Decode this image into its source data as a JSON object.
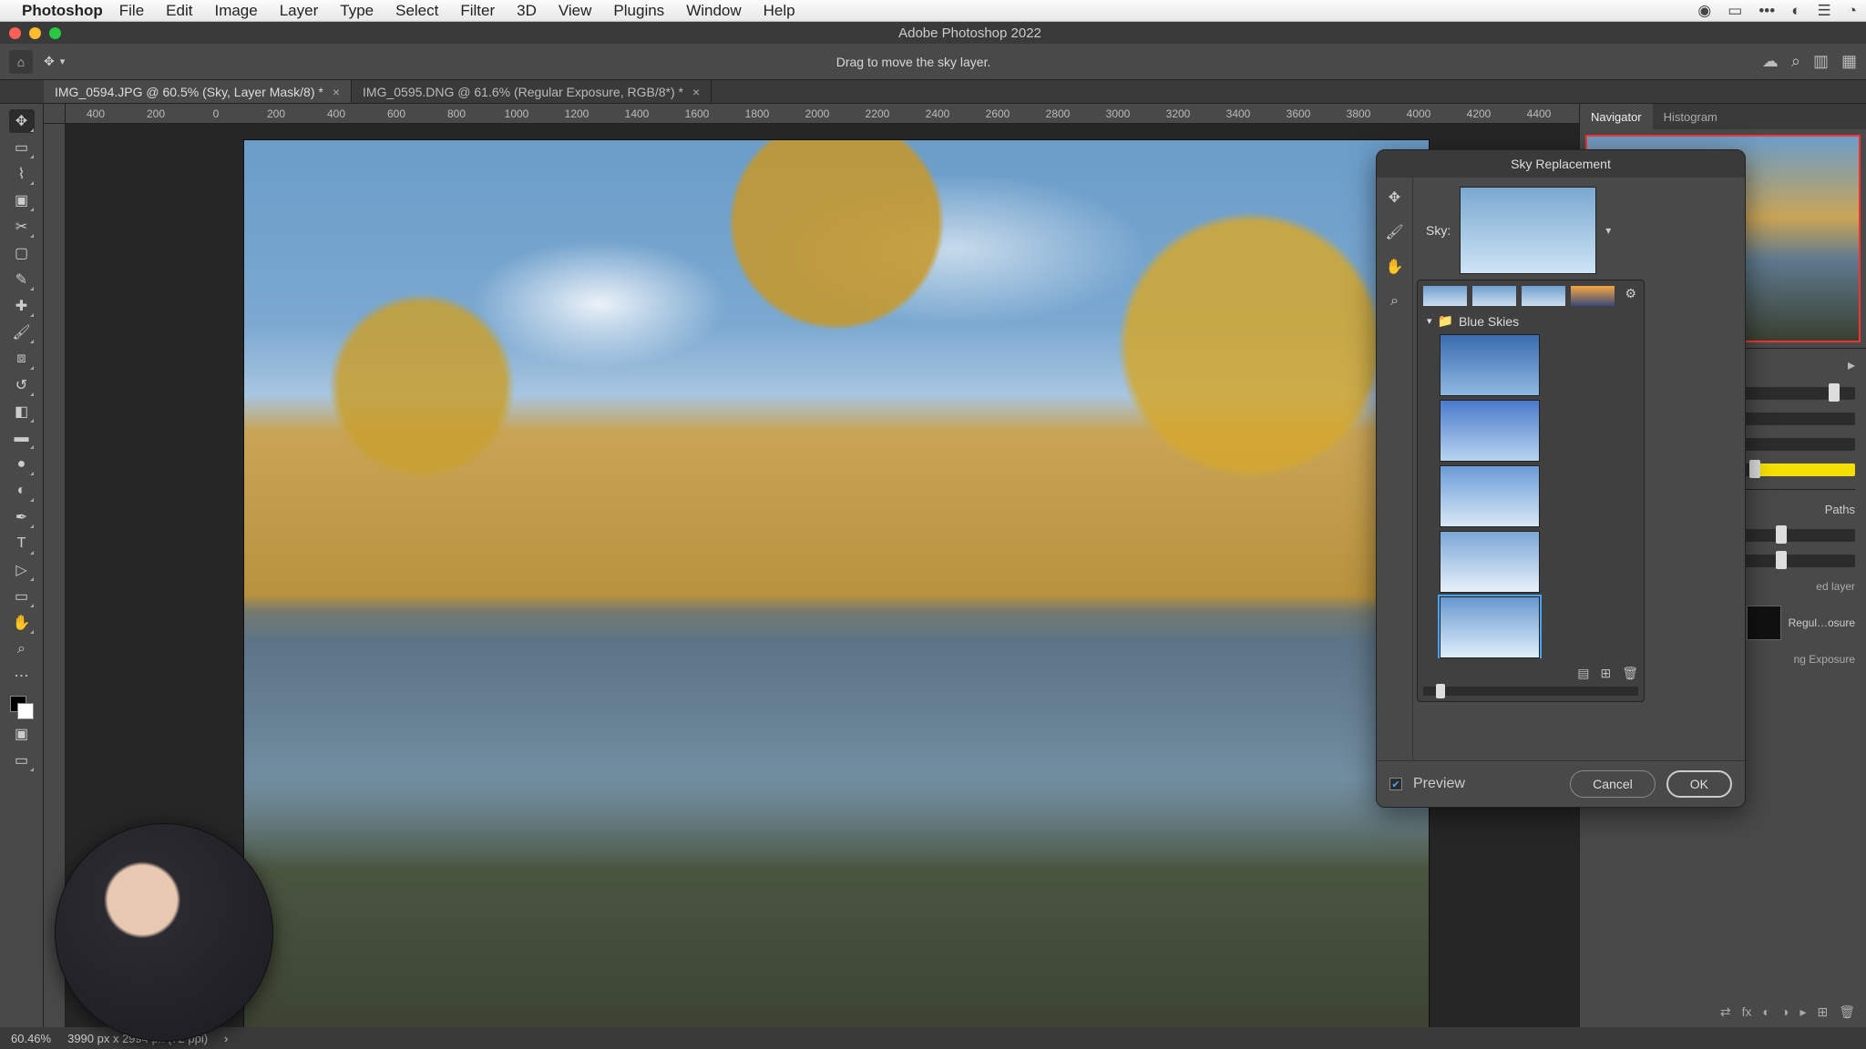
{
  "menubar": {
    "app": "Photoshop",
    "items": [
      "File",
      "Edit",
      "Image",
      "Layer",
      "Type",
      "Select",
      "Filter",
      "3D",
      "View",
      "Plugins",
      "Window",
      "Help"
    ]
  },
  "window_title": "Adobe Photoshop 2022",
  "options_hint": "Drag to move the sky layer.",
  "tabs": [
    {
      "label": "IMG_0594.JPG @ 60.5% (Sky, Layer Mask/8) *",
      "active": true
    },
    {
      "label": "IMG_0595.DNG @ 61.6% (Regular Exposure, RGB/8*) *",
      "active": false
    }
  ],
  "ruler_marks": [
    "400",
    "200",
    "0",
    "200",
    "400",
    "600",
    "800",
    "1000",
    "1200",
    "1400",
    "1600",
    "1800",
    "2000",
    "2200",
    "2400",
    "2600",
    "2800",
    "3000",
    "3200",
    "3400",
    "3600",
    "3800",
    "4000",
    "4200",
    "4400"
  ],
  "right_panel": {
    "tabs": [
      "Navigator",
      "Histogram"
    ],
    "paths_label": "Paths",
    "layer_hint": "ed layer",
    "layer_names": [
      "Regul…osure",
      "ng Exposure"
    ]
  },
  "sky_dialog": {
    "title": "Sky Replacement",
    "sky_label": "Sky:",
    "folder": "Blue Skies",
    "preview": "Preview",
    "cancel": "Cancel",
    "ok": "OK"
  },
  "status": {
    "zoom": "60.46%",
    "doc": "3990 px x 2994 px (72 ppi)"
  }
}
